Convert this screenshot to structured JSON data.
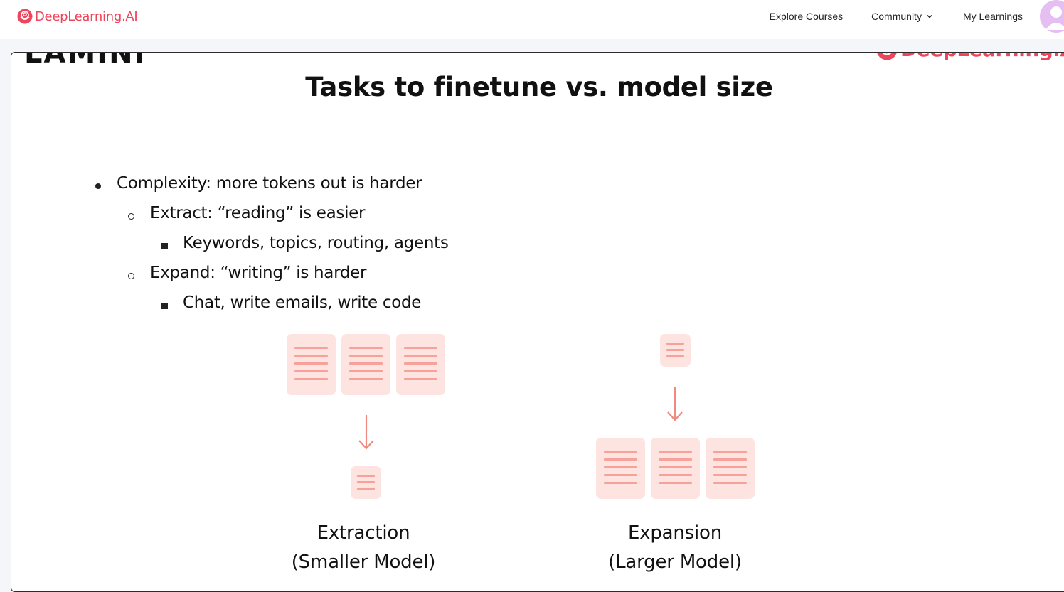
{
  "header": {
    "brand": "DeepLearning.AI",
    "nav": {
      "explore": "Explore Courses",
      "community": "Community",
      "my_learnings": "My Learnings"
    }
  },
  "slide": {
    "partner_logo": "LAMINI",
    "brand_logo": "DeepLearning.AI",
    "title": "Tasks to finetune vs. model size",
    "bullets": [
      "Complexity: more tokens out is harder",
      "Extract: “reading” is easier",
      "Keywords, topics, routing, agents",
      "Expand: “writing” is harder",
      "Chat, write emails, write code"
    ],
    "diagram": {
      "extraction": {
        "title": "Extraction",
        "subtitle": "(Smaller Model)"
      },
      "expansion": {
        "title": "Expansion",
        "subtitle": "(Larger Model)"
      }
    }
  },
  "colors": {
    "brand": "#f0445a",
    "doc_fill": "#fde4e1",
    "doc_lines": "#f6a19a",
    "arrow": "#f08a80",
    "avatar": "#e6bff2"
  },
  "icons": {
    "brand_mark": "deeplearning-logo-icon",
    "community_chevron": "chevron-down-icon",
    "avatar": "user-avatar-icon",
    "arrow": "arrow-down-icon",
    "document": "document-icon"
  }
}
